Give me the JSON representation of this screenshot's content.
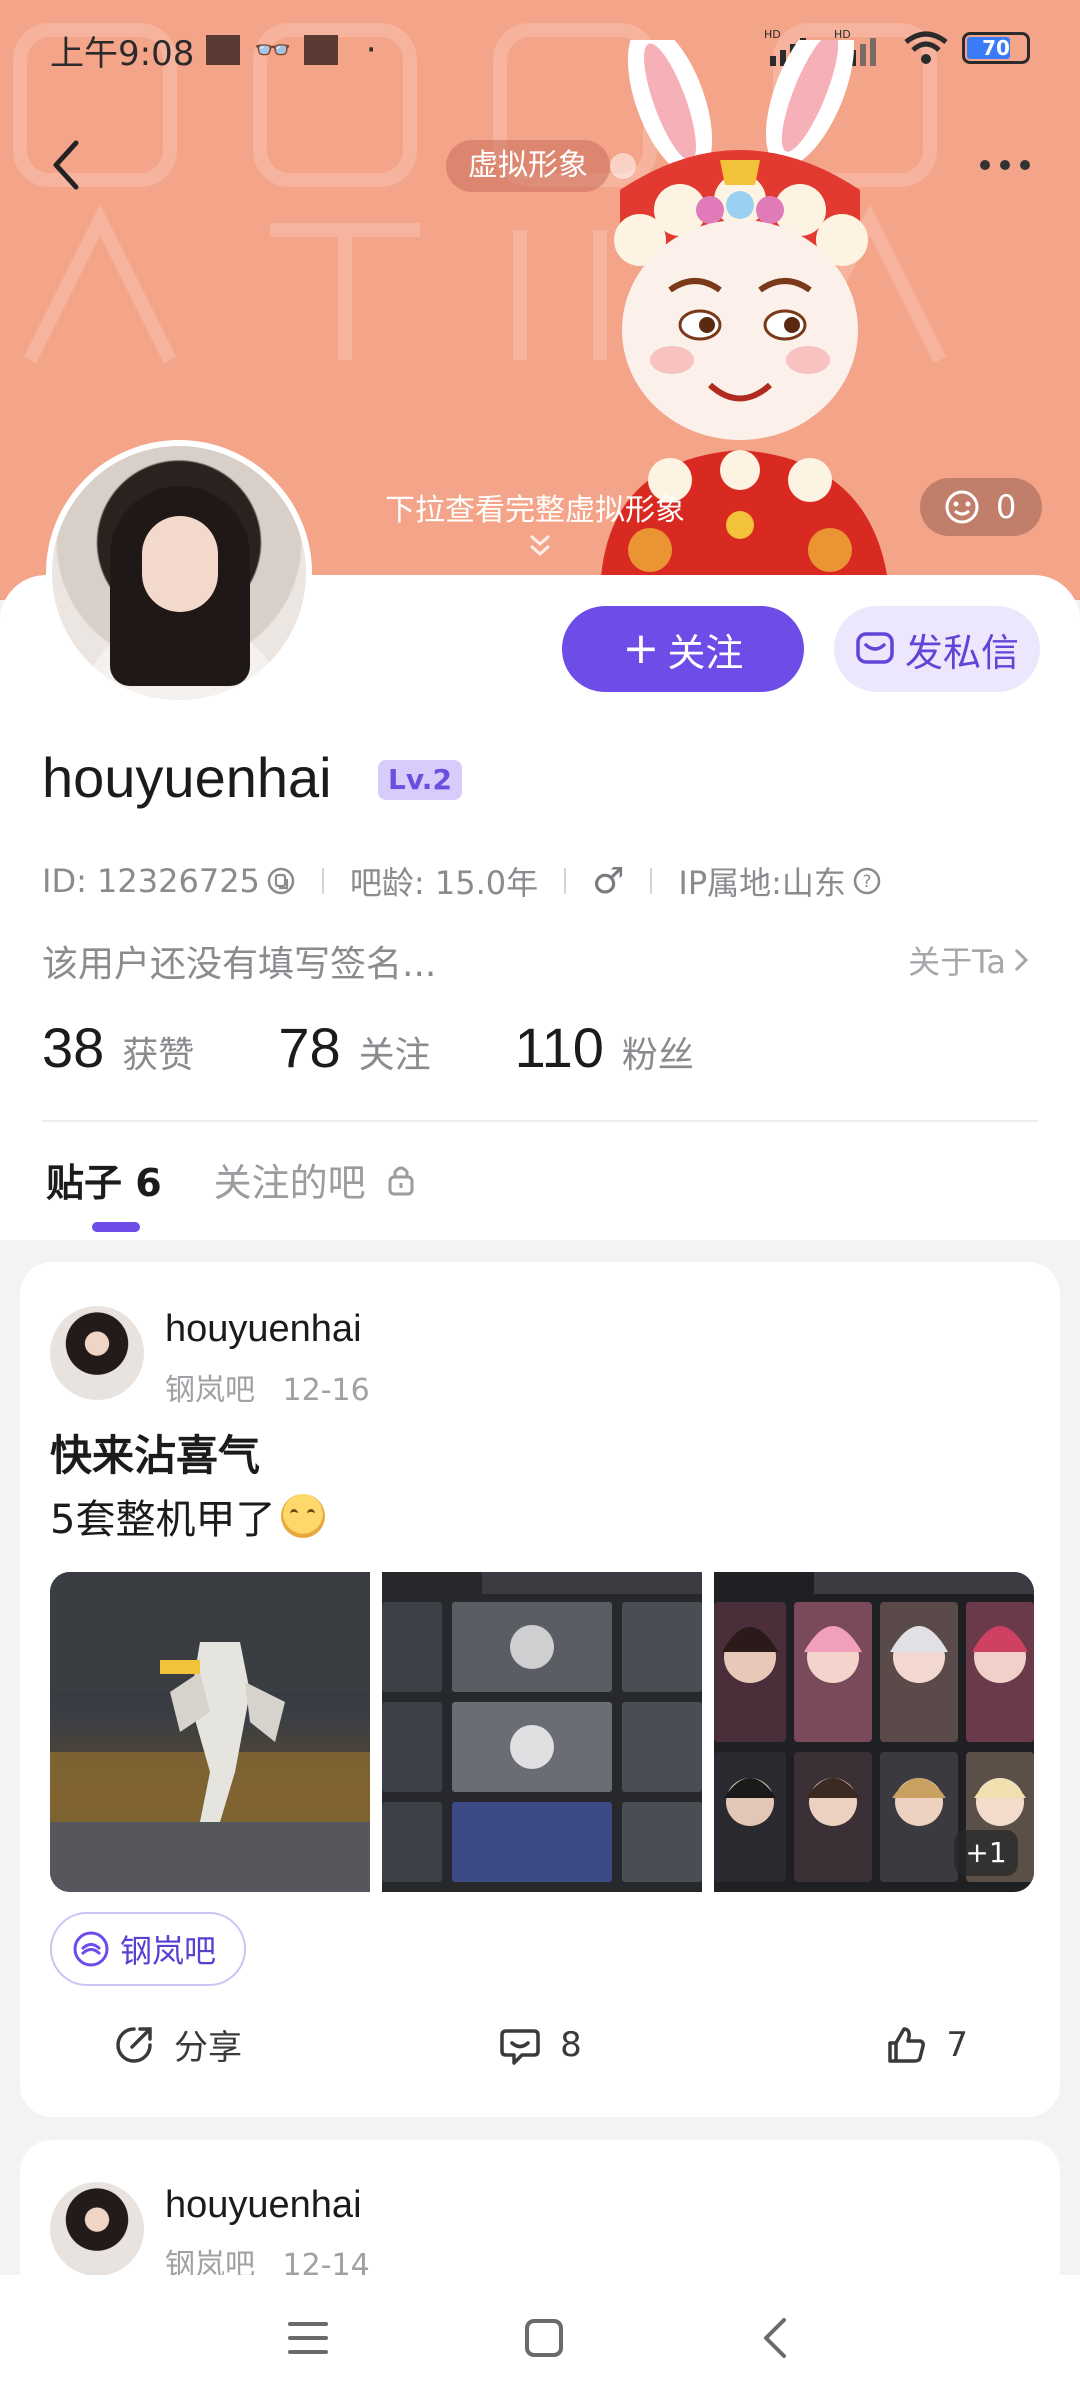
{
  "status_bar": {
    "time": "上午9:08",
    "battery": "70"
  },
  "header": {
    "avatar_chip": "虚拟形象",
    "pull_hint": "下拉查看完整虚拟形象",
    "like_count": "0"
  },
  "profile": {
    "username": "houyuenhai",
    "level": "Lv.2",
    "follow_label": "关注",
    "dm_label": "发私信",
    "id_text": "ID: 12326725",
    "age_text": "吧龄: 15.0年",
    "gender_symbol": "♂",
    "ip_text": "IP属地:山东",
    "signature": "该用户还没有填写签名...",
    "about_label": "关于Ta",
    "stats": [
      {
        "num": "38",
        "label": "获赞"
      },
      {
        "num": "78",
        "label": "关注"
      },
      {
        "num": "110",
        "label": "粉丝"
      }
    ]
  },
  "tabs": {
    "posts_label": "贴子 6",
    "forums_label": "关注的吧"
  },
  "posts": [
    {
      "author": "houyuenhai",
      "forum": "钢岚吧",
      "date": "12-16",
      "title": "快来沾喜气",
      "body": "5套整机甲了",
      "more_images": "+1",
      "forum_tag": "钢岚吧",
      "share_label": "分享",
      "comments": "8",
      "likes": "7"
    },
    {
      "author": "houyuenhai",
      "forum": "钢岚吧",
      "date": "12-14"
    }
  ],
  "colors": {
    "banner": "#f4a489",
    "accent": "#6d4ce8",
    "accent_light": "#ece7fc"
  }
}
